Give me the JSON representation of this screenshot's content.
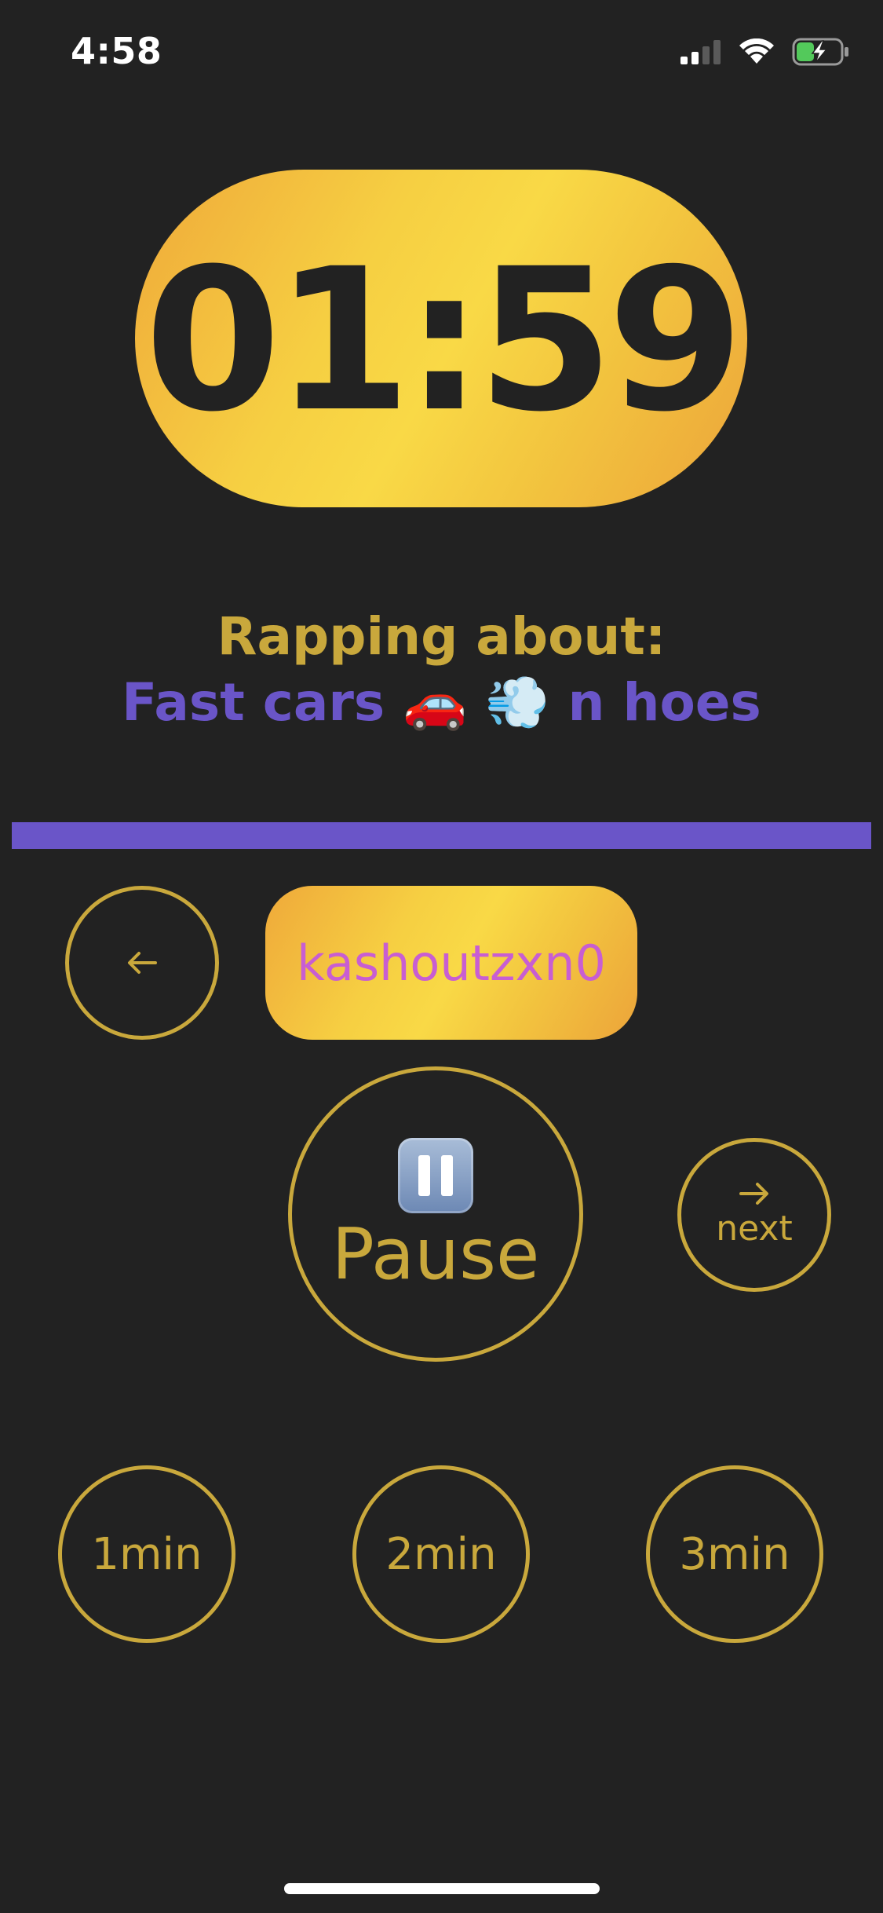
{
  "status_bar": {
    "time": "4:58",
    "signal_icon": "cellular-signal-icon",
    "wifi_icon": "wifi-icon",
    "battery_icon": "battery-charging-icon"
  },
  "timer": {
    "display": "01:59"
  },
  "topic": {
    "label": "Rapping about:",
    "value": "Fast cars 🚗 💨 n hoes"
  },
  "progress": {
    "fraction": 1.0
  },
  "controls": {
    "back_icon": "arrow-left-icon",
    "username": "kashoutzxn0",
    "pause_icon": "pause-icon",
    "pause_label": "Pause",
    "next_icon": "arrow-right-icon",
    "next_label": "next"
  },
  "durations": [
    {
      "label": "1min"
    },
    {
      "label": "2min"
    },
    {
      "label": "3min"
    }
  ],
  "colors": {
    "background": "#222222",
    "accent_gold": "#c9a83c",
    "accent_purple": "#6a55c8",
    "username_pink": "#c85ed2"
  }
}
